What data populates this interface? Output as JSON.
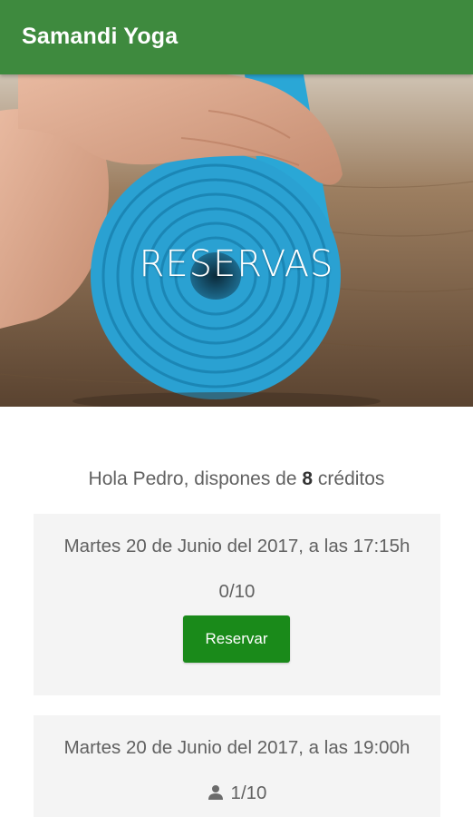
{
  "app_bar": {
    "title": "Samandi Yoga",
    "color": "#3e8a3e"
  },
  "hero": {
    "title": "RESERVAS"
  },
  "greeting": {
    "prefix": "Hola Pedro, dispones de ",
    "credits": "8",
    "suffix": " créditos"
  },
  "classes": [
    {
      "date": "Martes 20 de Junio del 2017, a las 17:15h",
      "occupancy": "0/10",
      "button_label": "Reservar",
      "show_user_icon": false
    },
    {
      "date": "Martes 20 de Junio del 2017, a las 19:00h",
      "occupancy": "1/10",
      "show_user_icon": true,
      "icon": "user-icon"
    }
  ],
  "colors": {
    "button": "#1a8a1a",
    "card_bg": "#f4f4f4",
    "text": "#616161"
  }
}
